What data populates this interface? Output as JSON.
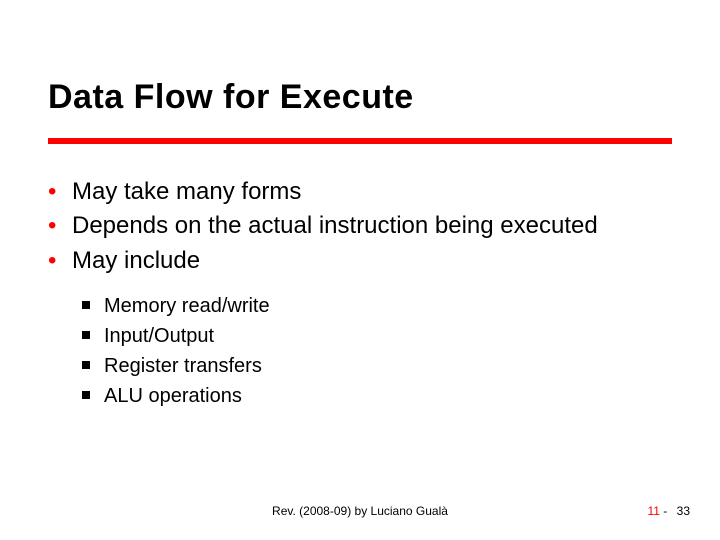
{
  "title": "Data Flow for Execute",
  "bullets": {
    "b0": "May take many forms",
    "b1": "Depends on the actual instruction being executed",
    "b2": "May include"
  },
  "sub": {
    "s0": "Memory read/write",
    "s1": "Input/Output",
    "s2": "Register transfers",
    "s3": "ALU operations"
  },
  "footer": {
    "center": "Rev. (2008-09) by Luciano Gualà",
    "chapter": "11",
    "sep": "-",
    "page": "33"
  }
}
